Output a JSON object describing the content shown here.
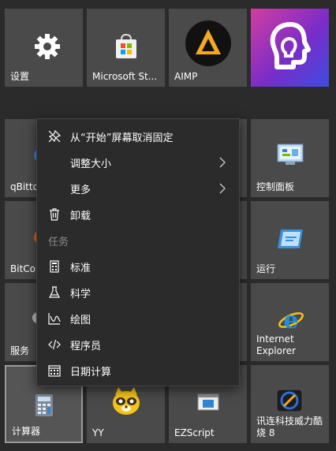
{
  "tiles": {
    "settings": "设置",
    "store": "Microsoft St...",
    "aimp": "AIMP",
    "qbittorrent": "qBitto",
    "control_panel": "控制面板",
    "bitcomet": "BitCom",
    "run": "运行",
    "services": "服务",
    "ie": "Internet Explorer",
    "calculator": "计算器",
    "yy": "YY",
    "ezscript": "EZScript",
    "xunlei": "讯连科技威力酷烧 8"
  },
  "menu": {
    "unpin": "从“开始”屏幕取消固定",
    "resize": "调整大小",
    "more": "更多",
    "uninstall": "卸载",
    "tasks_header": "任务",
    "standard": "标准",
    "scientific": "科学",
    "graphing": "绘图",
    "programmer": "程序员",
    "date_calc": "日期计算"
  },
  "colors": {
    "tile": "#4a4a4a",
    "menu_bg": "#2b2b2b",
    "accent_purple": "#7a2cc8",
    "ie_blue": "#1e8fe0"
  }
}
